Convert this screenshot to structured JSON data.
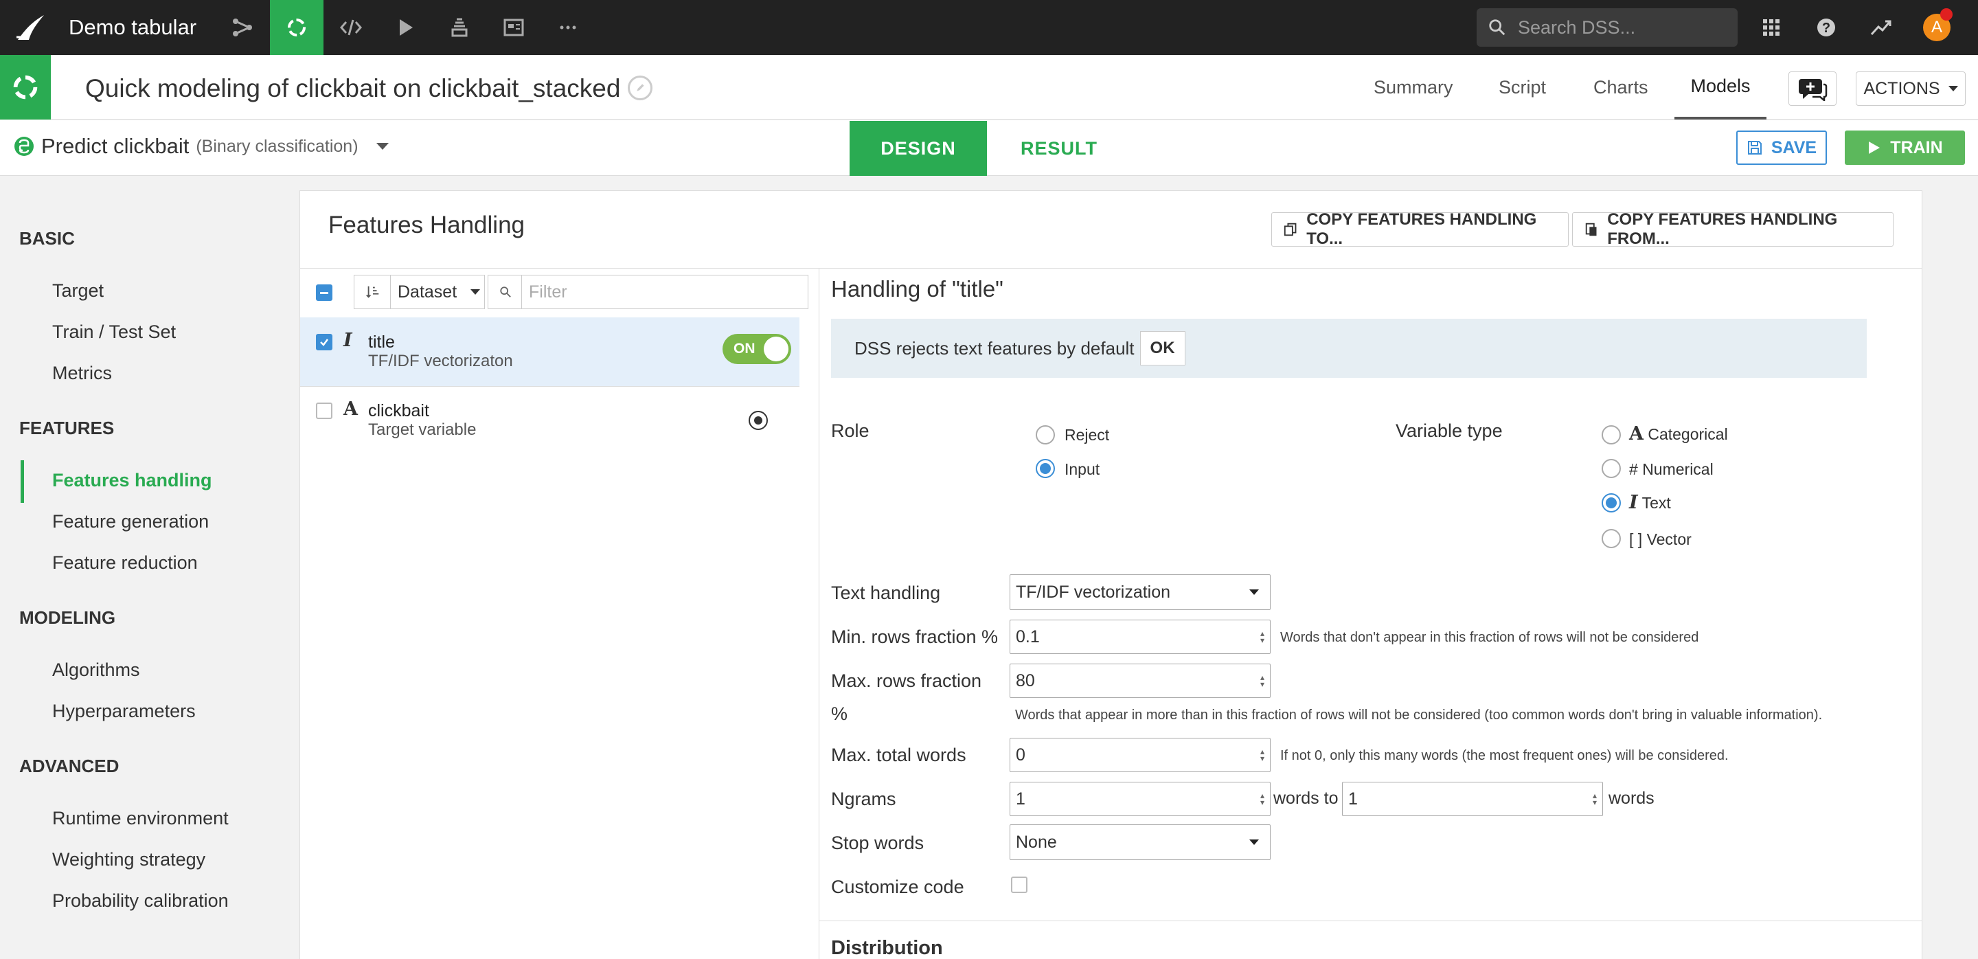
{
  "topbar": {
    "project_name": "Demo tabular",
    "search_placeholder": "Search DSS...",
    "avatar_letter": "A"
  },
  "header": {
    "title": "Quick modeling of clickbait on clickbait_stacked",
    "nav": [
      "Summary",
      "Script",
      "Charts",
      "Models"
    ],
    "active_nav": "Models",
    "actions_label": "ACTIONS"
  },
  "task": {
    "name": "Predict clickbait",
    "type": "(Binary classification)",
    "tabs": {
      "design": "DESIGN",
      "result": "RESULT"
    },
    "save_label": "SAVE",
    "train_label": "TRAIN"
  },
  "sidebar": {
    "sections": [
      {
        "heading": "BASIC",
        "items": [
          "Target",
          "Train / Test Set",
          "Metrics"
        ]
      },
      {
        "heading": "FEATURES",
        "items": [
          "Features handling",
          "Feature generation",
          "Feature reduction"
        ]
      },
      {
        "heading": "MODELING",
        "items": [
          "Algorithms",
          "Hyperparameters"
        ]
      },
      {
        "heading": "ADVANCED",
        "items": [
          "Runtime environment",
          "Weighting strategy",
          "Probability calibration"
        ]
      }
    ],
    "active_item": "Features handling"
  },
  "features": {
    "title": "Features Handling",
    "copy_to_label": "COPY FEATURES HANDLING TO...",
    "copy_from_label": "COPY FEATURES HANDLING FROM...",
    "sort_select": "Dataset",
    "filter_placeholder": "Filter",
    "list": [
      {
        "type_glyph": "I",
        "name": "title",
        "sub": "TF/IDF vectorizaton",
        "checked": true,
        "toggle": "ON"
      },
      {
        "type_glyph": "A",
        "name": "clickbait",
        "sub": "Target variable",
        "checked": false
      }
    ]
  },
  "detail": {
    "title": "Handling of \"title\"",
    "notice": "DSS rejects text features by default",
    "ok_label": "OK",
    "role_label": "Role",
    "roles": [
      "Reject",
      "Input"
    ],
    "selected_role": "Input",
    "vartype_label": "Variable type",
    "vartypes": [
      {
        "glyph": "A",
        "label": "Categorical"
      },
      {
        "glyph": "#",
        "label": "Numerical"
      },
      {
        "glyph": "I",
        "label": "Text"
      },
      {
        "glyph": "[ ]",
        "label": "Vector"
      }
    ],
    "selected_vartype": "Text",
    "text_handling_label": "Text handling",
    "text_handling_value": "TF/IDF vectorization",
    "min_rows_label": "Min. rows fraction %",
    "min_rows_value": "0.1",
    "min_rows_hint": "Words that don't appear in this fraction of rows will not be considered",
    "max_rows_label_1": "Max. rows fraction",
    "max_rows_label_2": "%",
    "max_rows_value": "80",
    "max_rows_hint": "Words that appear in more than in this fraction of rows will not be considered (too common words don't bring in valuable information).",
    "max_words_label": "Max. total words",
    "max_words_value": "0",
    "max_words_hint": "If not 0, only this many words (the most frequent ones) will be considered.",
    "ngrams_label": "Ngrams",
    "ngrams_from": "1",
    "ngrams_mid": "words to",
    "ngrams_to": "1",
    "ngrams_end": "words",
    "stopwords_label": "Stop words",
    "stopwords_value": "None",
    "customize_label": "Customize code",
    "distribution_label": "Distribution"
  }
}
